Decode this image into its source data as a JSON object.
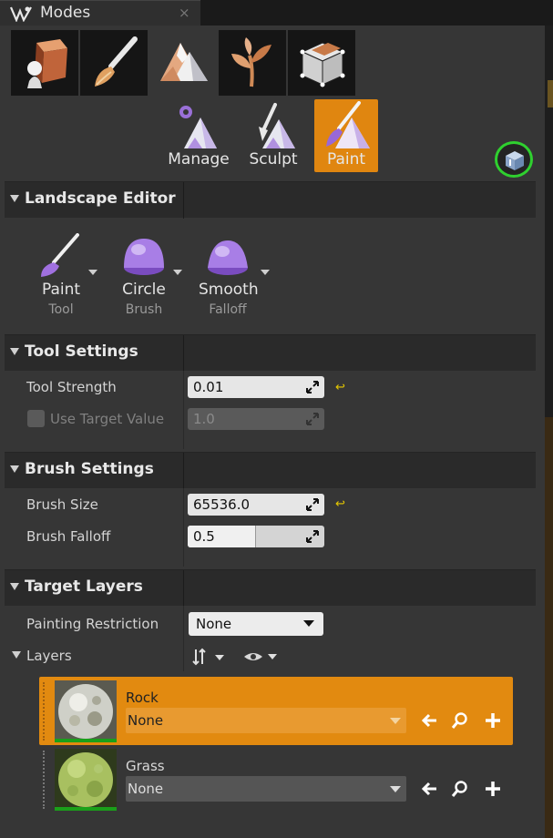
{
  "window": {
    "title": "Modes",
    "close_symbol": "×"
  },
  "mode_buttons": [
    {
      "name": "place-mode-icon",
      "active": false
    },
    {
      "name": "paint-mode-icon",
      "active": false
    },
    {
      "name": "landscape-mode-icon",
      "active": true
    },
    {
      "name": "foliage-mode-icon",
      "active": false
    },
    {
      "name": "geometry-mode-icon",
      "active": false
    }
  ],
  "sub_tools": [
    {
      "label": "Manage",
      "icon": "manage-icon",
      "active": false
    },
    {
      "label": "Sculpt",
      "icon": "sculpt-icon",
      "active": false
    },
    {
      "label": "Paint",
      "icon": "paint-icon",
      "active": true
    }
  ],
  "landscape_editor": {
    "title": "Landscape Editor",
    "tools": [
      {
        "label": "Paint",
        "sublabel": "Tool",
        "icon": "paint-brush-icon"
      },
      {
        "label": "Circle",
        "sublabel": "Brush",
        "icon": "circle-brush-icon"
      },
      {
        "label": "Smooth",
        "sublabel": "Falloff",
        "icon": "smooth-falloff-icon"
      }
    ]
  },
  "tool_settings": {
    "title": "Tool Settings",
    "tool_strength_label": "Tool Strength",
    "tool_strength_value": "0.01",
    "use_target_value_label": "Use Target Value",
    "use_target_value_checked": false,
    "target_value": "1.0"
  },
  "brush_settings": {
    "title": "Brush Settings",
    "brush_size_label": "Brush Size",
    "brush_size_value": "65536.0",
    "brush_falloff_label": "Brush Falloff",
    "brush_falloff_value": "0.5",
    "brush_falloff_fraction": 0.5
  },
  "target_layers": {
    "title": "Target Layers",
    "painting_restriction_label": "Painting Restriction",
    "painting_restriction_value": "None",
    "layers_label": "Layers",
    "layers": [
      {
        "name": "Rock",
        "dropdown_value": "None",
        "selected": true
      },
      {
        "name": "Grass",
        "dropdown_value": "None",
        "selected": false
      }
    ]
  },
  "colors": {
    "accent": "#e08610",
    "help_ring": "#2fd02f",
    "reset_arrow": "#e6c800"
  }
}
